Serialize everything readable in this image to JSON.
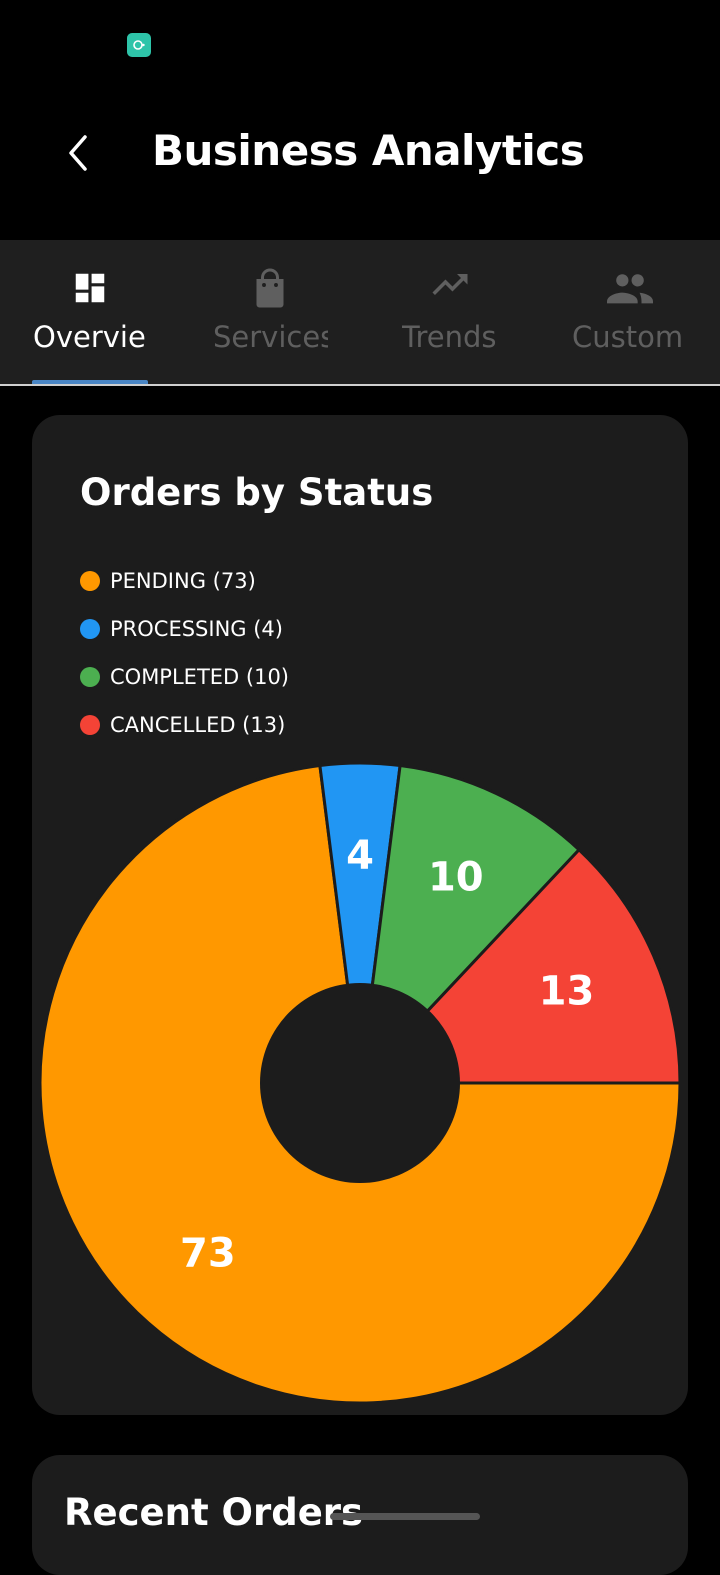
{
  "header": {
    "title": "Business Analytics"
  },
  "tabs": [
    {
      "label": "Overvie",
      "icon": "dashboard-icon",
      "active": true
    },
    {
      "label": "Services",
      "icon": "shopping-bag-icon",
      "active": false
    },
    {
      "label": "Trends",
      "icon": "trending-up-icon",
      "active": false
    },
    {
      "label": "Custom",
      "icon": "people-icon",
      "active": false
    }
  ],
  "orders_card": {
    "title": "Orders by Status",
    "legend": [
      {
        "label": "PENDING (73)",
        "color": "#ff9800"
      },
      {
        "label": "PROCESSING (4)",
        "color": "#2196f3"
      },
      {
        "label": "COMPLETED (10)",
        "color": "#4caf50"
      },
      {
        "label": "CANCELLED (13)",
        "color": "#f44336"
      }
    ]
  },
  "recent_card": {
    "title": "Recent Orders"
  },
  "colors": {
    "background": "#000000",
    "card": "#1c1c1c",
    "tab_bar": "#1f1f1f",
    "tab_indicator": "#4a86c5",
    "status_app_icon": "#2ec4a9"
  },
  "chart_data": {
    "type": "pie",
    "categories": [
      "PENDING",
      "PROCESSING",
      "COMPLETED",
      "CANCELLED"
    ],
    "values": [
      73,
      4,
      10,
      13
    ],
    "colors": [
      "#ff9800",
      "#2196f3",
      "#4caf50",
      "#f44336"
    ],
    "data_labels": [
      "73",
      "4",
      "10",
      "13"
    ],
    "donut": true,
    "legend_position": "top-left"
  }
}
